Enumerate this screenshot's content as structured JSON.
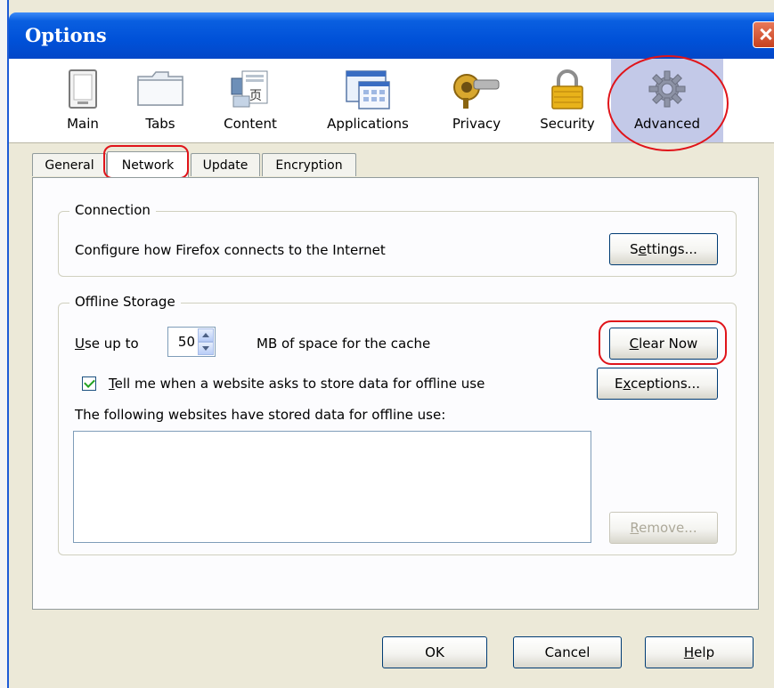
{
  "window": {
    "title": "Options"
  },
  "panes": [
    {
      "label": "Main",
      "icon": "main-window-icon"
    },
    {
      "label": "Tabs",
      "icon": "tabs-folder-icon"
    },
    {
      "label": "Content",
      "icon": "content-page-icon"
    },
    {
      "label": "Applications",
      "icon": "applications-window-icon"
    },
    {
      "label": "Privacy",
      "icon": "privacy-mask-icon"
    },
    {
      "label": "Security",
      "icon": "lock-icon"
    },
    {
      "label": "Advanced",
      "icon": "gear-icon",
      "selected": true
    }
  ],
  "tabs": [
    {
      "label": "General"
    },
    {
      "label": "Network",
      "active": true
    },
    {
      "label": "Update"
    },
    {
      "label": "Encryption"
    }
  ],
  "connection": {
    "legend": "Connection",
    "description": "Configure how Firefox connects to the Internet",
    "settings_button": {
      "pre": "S",
      "accel": "e",
      "post": "ttings..."
    }
  },
  "offline": {
    "legend": "Offline Storage",
    "use_up_to": {
      "accel": "U",
      "post": "se up to"
    },
    "cache_value": "50",
    "cache_suffix": "MB of space for the cache",
    "clear_now": {
      "accel": "C",
      "post": "lear Now"
    },
    "tell_me": {
      "accel": "T",
      "post": "ell me when a website asks to store data for offline use",
      "checked": true
    },
    "exceptions": {
      "pre": "E",
      "accel": "x",
      "post": "ceptions..."
    },
    "stored_label": "The following websites have stored data for offline use:",
    "remove": {
      "accel": "R",
      "post": "emove..."
    }
  },
  "footer": {
    "ok": "OK",
    "cancel": "Cancel",
    "help": {
      "accel": "H",
      "post": "elp"
    }
  },
  "colors": {
    "titlebar": "#0051d8",
    "annotation_red": "#e0141a",
    "selected_pane": "#c3c9e8",
    "dialog_bg": "#ece9d8"
  }
}
